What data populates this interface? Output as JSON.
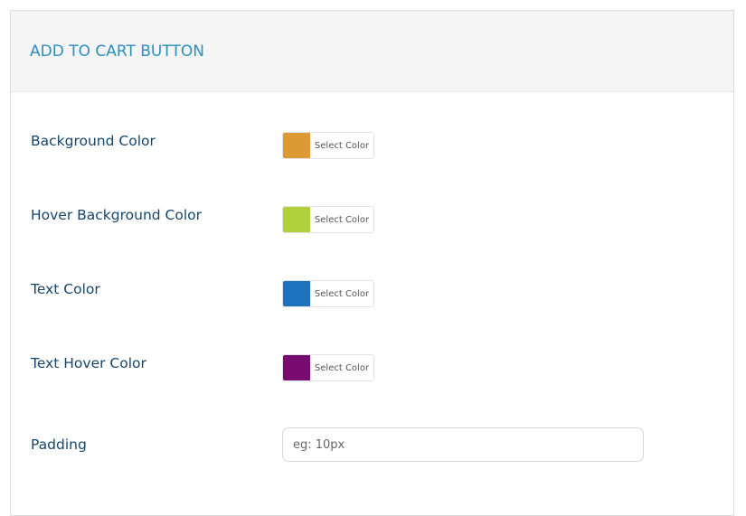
{
  "section": {
    "title": "ADD TO CART BUTTON"
  },
  "fields": [
    {
      "label": "Background Color",
      "button": "Select Color",
      "color": "#dd9933"
    },
    {
      "label": "Hover Background Color",
      "button": "Select Color",
      "color": "#b1d03b"
    },
    {
      "label": "Text Color",
      "button": "Select Color",
      "color": "#1e73be"
    },
    {
      "label": "Text Hover Color",
      "button": "Select Color",
      "color": "#770b6f"
    }
  ],
  "padding": {
    "label": "Padding",
    "value": "",
    "placeholder": "eg: 10px"
  }
}
